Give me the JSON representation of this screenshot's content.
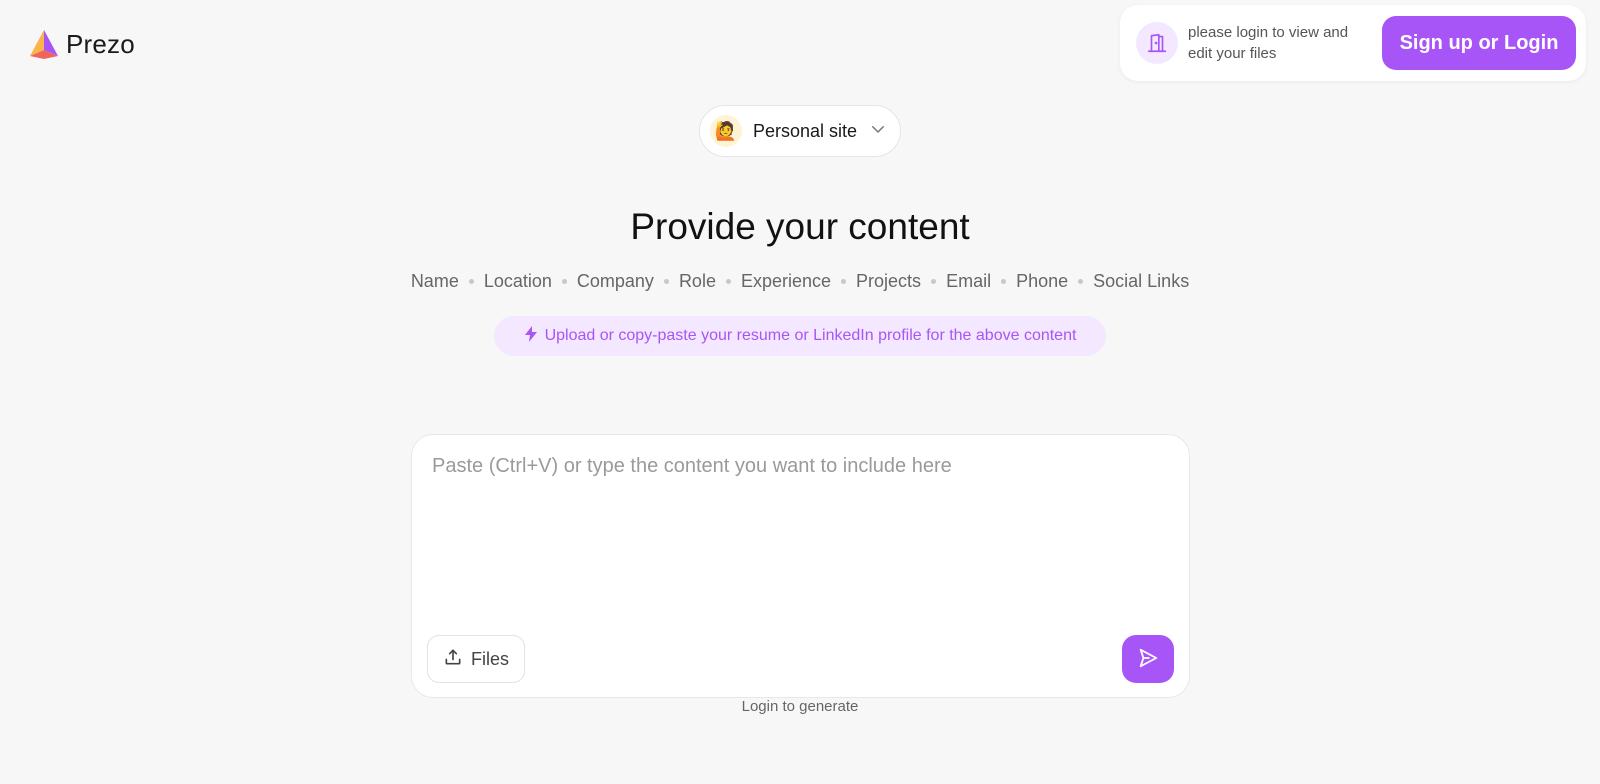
{
  "brand": {
    "name": "Prezo"
  },
  "login_card": {
    "message": "please login to view and edit your files",
    "button_label": "Sign up or Login"
  },
  "site_selector": {
    "emoji": "🙋",
    "selected": "Personal site"
  },
  "heading": "Provide your content",
  "fields": [
    "Name",
    "Location",
    "Company",
    "Role",
    "Experience",
    "Projects",
    "Email",
    "Phone",
    "Social Links"
  ],
  "hint": "Upload or copy-paste your resume or LinkedIn profile for the above content",
  "composer": {
    "placeholder": "Paste (Ctrl+V) or type the content you want to include here",
    "value": "",
    "files_label": "Files"
  },
  "footer_note": "Login to generate",
  "colors": {
    "accent": "#a855f7",
    "accent_soft": "#f3e8ff",
    "background": "#f7f7f7"
  },
  "icons": {
    "logo": "prism-logo-icon",
    "door": "door-icon",
    "chevron": "chevron-down-icon",
    "bolt": "lightning-icon",
    "upload": "upload-icon",
    "send": "send-icon"
  }
}
